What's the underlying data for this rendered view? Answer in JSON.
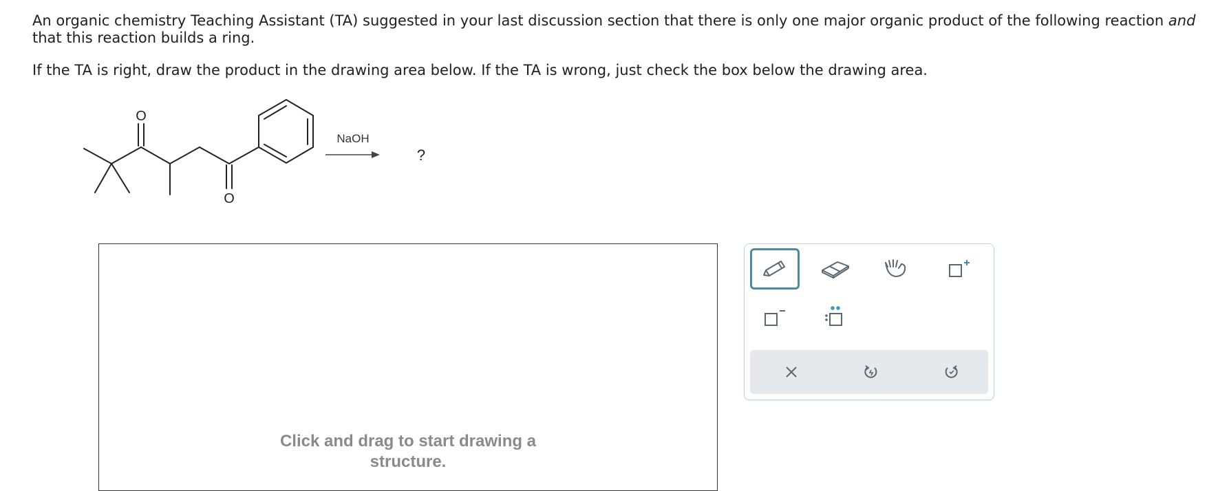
{
  "question": {
    "para1_part1": "An organic chemistry Teaching Assistant (TA) suggested in your last discussion section that there is only one major organic product of the following reaction ",
    "para1_emphasis": "and",
    "para1_part2": " that this reaction builds a ring.",
    "para2": "If the TA is right, draw the product in the drawing area below. If the TA is wrong, just check the box below the drawing area."
  },
  "reaction": {
    "oxygen_label_top": "O",
    "oxygen_label_bottom": "O",
    "reagent": "NaOH",
    "product": "?"
  },
  "canvas": {
    "hint": "Click and drag to start drawing a structure."
  },
  "toolbar": {
    "tools": [
      {
        "name": "pencil-tool",
        "icon": "pencil-icon",
        "active": true
      },
      {
        "name": "eraser-tool",
        "icon": "eraser-icon",
        "active": false
      },
      {
        "name": "hand-tool",
        "icon": "hand-icon",
        "active": false
      },
      {
        "name": "add-positive-charge-tool",
        "icon": "positive-charge-icon",
        "active": false
      },
      {
        "name": "add-negative-charge-tool",
        "icon": "negative-charge-icon",
        "active": false
      },
      {
        "name": "add-lone-pair-tool",
        "icon": "lone-pair-icon",
        "active": false
      }
    ],
    "actions": [
      {
        "name": "clear-button",
        "icon": "close-icon"
      },
      {
        "name": "undo-button",
        "icon": "undo-icon"
      },
      {
        "name": "redo-button",
        "icon": "redo-icon"
      }
    ],
    "colors": {
      "accent": "#4f8aa3",
      "icon": "#5a6770",
      "plus": "#3a8fb0",
      "lone_pair": "#3a9bbf",
      "action_bg": "#e6e9eb"
    }
  }
}
